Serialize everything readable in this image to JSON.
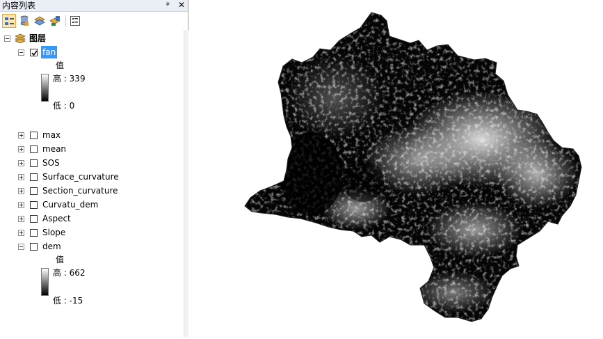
{
  "panel": {
    "title": "内容列表",
    "pin_glyph": "ᵖ",
    "close_glyph": "✕"
  },
  "toolbar": {
    "buttons": [
      {
        "name": "list-by-drawing-order-icon",
        "active": true
      },
      {
        "name": "list-by-source-icon",
        "active": false
      },
      {
        "name": "list-by-visibility-icon",
        "active": false
      },
      {
        "name": "list-by-selection-icon",
        "active": false
      },
      {
        "name": "options-icon",
        "active": false
      }
    ]
  },
  "tree": {
    "root_label": "图层",
    "fan": {
      "label": "fan",
      "checked": true,
      "legend_heading": "值",
      "high": "高 : 339",
      "low": "低 : 0"
    },
    "layers": [
      {
        "label": "max",
        "checked": false
      },
      {
        "label": "mean",
        "checked": false
      },
      {
        "label": "SOS",
        "checked": false
      },
      {
        "label": "Surface_curvature",
        "checked": false
      },
      {
        "label": "Section_curvature",
        "checked": false
      },
      {
        "label": "Curvatu_dem",
        "checked": false
      },
      {
        "label": "Aspect",
        "checked": false
      },
      {
        "label": "Slope",
        "checked": false
      }
    ],
    "dem": {
      "label": "dem",
      "checked": false,
      "legend_heading": "值",
      "high": "高 : 662",
      "low": "低 : -15"
    }
  },
  "colors": {
    "selection": "#3399ff",
    "active_tool_border": "#e8a83c",
    "raster_bg": "#000000"
  }
}
